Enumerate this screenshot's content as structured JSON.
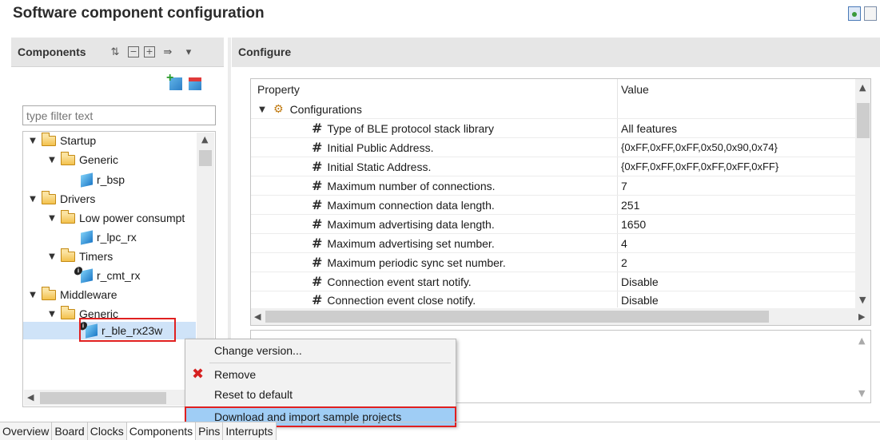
{
  "page": {
    "title": "Software component configuration"
  },
  "left_panel": {
    "header": "Components",
    "filter_placeholder": "type filter text",
    "tree": [
      {
        "label": "Startup",
        "kind": "folder",
        "level": 0
      },
      {
        "label": "Generic",
        "kind": "folder",
        "level": 1
      },
      {
        "label": "r_bsp",
        "kind": "component",
        "level": 2
      },
      {
        "label": "Drivers",
        "kind": "folder",
        "level": 0
      },
      {
        "label": "Low power consumpt",
        "kind": "folder",
        "level": 1
      },
      {
        "label": "r_lpc_rx",
        "kind": "component",
        "level": 2
      },
      {
        "label": "Timers",
        "kind": "folder",
        "level": 1
      },
      {
        "label": "r_cmt_rx",
        "kind": "component",
        "level": 2
      },
      {
        "label": "Middleware",
        "kind": "folder",
        "level": 0
      },
      {
        "label": "Generic",
        "kind": "folder",
        "level": 1
      },
      {
        "label": "r_ble_rx23w",
        "kind": "component",
        "level": 2
      }
    ],
    "toolbar_icons": [
      "sort-az-icon",
      "collapse-all-icon",
      "expand-all-icon",
      "view-menu-icon",
      "dropdown-icon"
    ],
    "add_icons": [
      "add-component-icon",
      "remove-component-icon"
    ]
  },
  "right_panel": {
    "header": "Configure",
    "columns": {
      "property": "Property",
      "value": "Value"
    },
    "group": "Configurations",
    "rows": [
      {
        "name": "Type of BLE protocol stack library",
        "value": "All features"
      },
      {
        "name": "Initial Public Address.",
        "value": "{0xFF,0xFF,0xFF,0x50,0x90,0x74}"
      },
      {
        "name": "Initial Static Address.",
        "value": "{0xFF,0xFF,0xFF,0xFF,0xFF,0xFF}"
      },
      {
        "name": "Maximum number of connections.",
        "value": "7"
      },
      {
        "name": "Maximum connection data length.",
        "value": "251"
      },
      {
        "name": "Maximum advertising data length.",
        "value": "1650"
      },
      {
        "name": "Maximum advertising set number.",
        "value": "4"
      },
      {
        "name": "Maximum periodic sync set number.",
        "value": "2"
      },
      {
        "name": "Connection event start notify.",
        "value": "Disable"
      },
      {
        "name": "Connection event close notify.",
        "value": "Disable"
      }
    ]
  },
  "context_menu": {
    "items": [
      {
        "label": "Change version..."
      },
      {
        "label": "Remove"
      },
      {
        "label": "Reset to default"
      },
      {
        "label": "Download and import sample projects"
      }
    ]
  },
  "tabs": [
    "Overview",
    "Board",
    "Clocks",
    "Components",
    "Pins",
    "Interrupts"
  ],
  "active_tab": "Components",
  "colors": {
    "highlight": "#9fcdf5",
    "selection": "#cfe3f8",
    "callout": "#e02020",
    "folder": "#f3c14d"
  }
}
